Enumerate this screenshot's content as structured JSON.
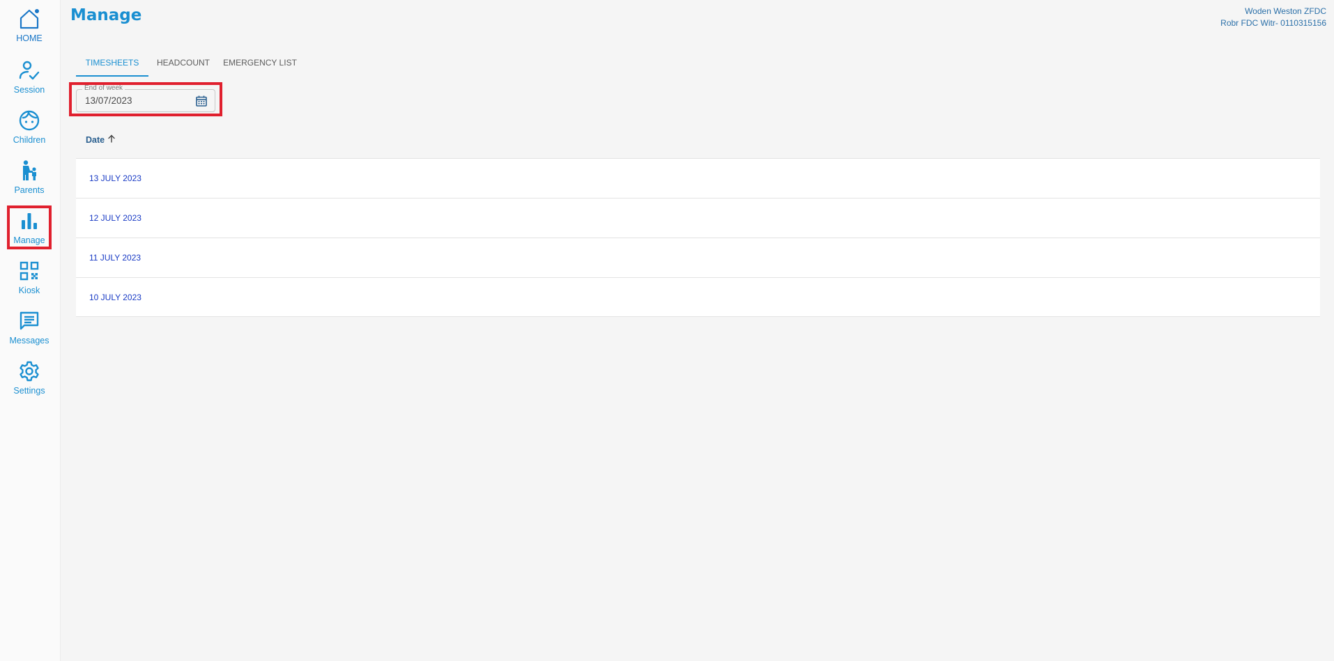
{
  "sidebar": {
    "items": [
      {
        "label": "HOME",
        "icon": "home-icon"
      },
      {
        "label": "Session",
        "icon": "person-check-icon"
      },
      {
        "label": "Children",
        "icon": "child-face-icon"
      },
      {
        "label": "Parents",
        "icon": "parent-child-icon"
      },
      {
        "label": "Manage",
        "icon": "bar-chart-icon"
      },
      {
        "label": "Kiosk",
        "icon": "qr-code-icon"
      },
      {
        "label": "Messages",
        "icon": "message-icon"
      },
      {
        "label": "Settings",
        "icon": "gear-icon"
      }
    ],
    "active": "Manage"
  },
  "header": {
    "title": "Manage",
    "user_line1": "Woden Weston ZFDC",
    "user_line2": "Robr FDC Witr- 0110315156"
  },
  "tabs": [
    {
      "label": "TIMESHEETS",
      "active": true
    },
    {
      "label": "HEADCOUNT",
      "active": false
    },
    {
      "label": "EMERGENCY LIST",
      "active": false
    }
  ],
  "filter": {
    "end_of_week_label": "End of week",
    "end_of_week_value": "13/07/2023"
  },
  "table": {
    "column_header": "Date",
    "sort": "ascending",
    "rows": [
      {
        "date": "13 JULY 2023"
      },
      {
        "date": "12 JULY 2023"
      },
      {
        "date": "11 JULY 2023"
      },
      {
        "date": "10 JULY 2023"
      }
    ]
  },
  "colors": {
    "accent": "#1a8fd1",
    "highlight": "#e0202e",
    "row_link": "#1739c4"
  }
}
